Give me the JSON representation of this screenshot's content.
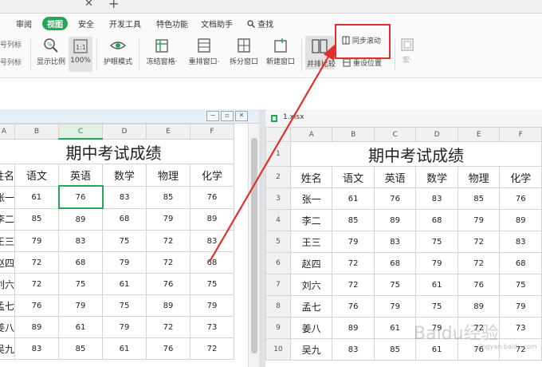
{
  "tabstrip": {
    "close_glyph": "✕",
    "add_glyph": "+"
  },
  "menu": {
    "items": [
      "审阅",
      "视图",
      "安全",
      "开发工具",
      "特色功能",
      "文档助手",
      "查找"
    ],
    "active": "视图"
  },
  "toolbar": {
    "left_clip_1": "号列标",
    "left_clip_2": "号列标",
    "buttons": [
      {
        "key": "zoom",
        "label": "显示比例",
        "icon": "magnifier-icon"
      },
      {
        "key": "hundred",
        "label": "100%",
        "icon": "one-to-one-icon"
      },
      {
        "key": "eye",
        "label": "护眼模式",
        "icon": "eye-icon"
      },
      {
        "key": "freeze",
        "label": "冻结窗格·",
        "icon": "freeze-panes-icon"
      },
      {
        "key": "rearrange",
        "label": "重排窗口·",
        "icon": "rearrange-window-icon"
      },
      {
        "key": "split",
        "label": "拆分窗口",
        "icon": "split-window-icon"
      },
      {
        "key": "newwin",
        "label": "新建窗口",
        "icon": "new-window-icon"
      },
      {
        "key": "sbs",
        "label": "并排比较",
        "icon": "side-by-side-icon"
      }
    ],
    "sync_label": "同步滚动",
    "reset_label": "重设位置",
    "macro_label": "宏·"
  },
  "colors": {
    "accent": "#27a55a",
    "highlight": "#e0302d"
  },
  "right_pane": {
    "file_name": "1.xlsx"
  },
  "sheet": {
    "title": "期中考试成绩",
    "headers": [
      "姓名",
      "语文",
      "英语",
      "数学",
      "物理",
      "化学"
    ],
    "rows": [
      {
        "name": "张一",
        "v": [
          61,
          76,
          83,
          85,
          76
        ]
      },
      {
        "name": "李二",
        "v": [
          85,
          89,
          68,
          79,
          89
        ]
      },
      {
        "name": "王三",
        "v": [
          79,
          83,
          75,
          72,
          83
        ]
      },
      {
        "name": "赵四",
        "v": [
          72,
          68,
          79,
          72,
          68
        ]
      },
      {
        "name": "刘六",
        "v": [
          72,
          75,
          61,
          76,
          75
        ]
      },
      {
        "name": "孟七",
        "v": [
          76,
          79,
          75,
          89,
          79
        ]
      },
      {
        "name": "姜八",
        "v": [
          89,
          61,
          79,
          72,
          73
        ]
      },
      {
        "name": "吴九",
        "v": [
          83,
          85,
          61,
          76,
          72
        ]
      }
    ],
    "left_cols": [
      "A",
      "B",
      "C",
      "D",
      "E",
      "F"
    ],
    "right_cols": [
      "A",
      "B",
      "C",
      "D",
      "E",
      "F"
    ],
    "right_row_numbers": [
      "1",
      "2",
      "3",
      "4",
      "5",
      "6",
      "7",
      "8",
      "9",
      "10"
    ]
  },
  "watermark": {
    "text": "Baidu经验",
    "sub": "jingyan.baidu.com"
  }
}
